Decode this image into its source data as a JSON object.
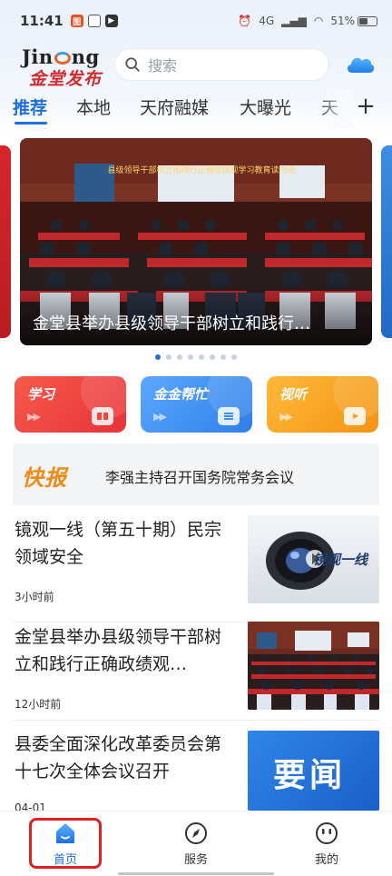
{
  "status_bar": {
    "time": "11:41",
    "network": "4G",
    "battery": "51%"
  },
  "header": {
    "logo_en": "Jin",
    "logo_en_tail": "ng",
    "logo_cn": "金堂发布",
    "search_placeholder": "搜索"
  },
  "tabs": [
    {
      "label": "推荐",
      "active": true
    },
    {
      "label": "本地"
    },
    {
      "label": "天府融媒"
    },
    {
      "label": "大曝光"
    },
    {
      "label": "天"
    }
  ],
  "banner": {
    "caption": "金堂县举办县级领导干部树立和践行…",
    "slide_banner": "县级领导干部树立和践行正确政绩观学习教育读书班",
    "slides": 8,
    "active_slide": 1
  },
  "feature_cards": [
    {
      "label": "学习",
      "color": "#f0463c"
    },
    {
      "label": "金金帮忙",
      "color": "#3a8ff0"
    },
    {
      "label": "视听",
      "color": "#f7a01e"
    }
  ],
  "quick_news": {
    "logo": "快报",
    "text": "李强主持召开国务院常务会议"
  },
  "news": [
    {
      "title": "镜观一线（第五十期）民宗领域安全",
      "time": "3小时前",
      "thumb_text": "镜观一线"
    },
    {
      "title": "金堂县举办县级领导干部树立和践行正确政绩观…",
      "time": "12小时前"
    },
    {
      "title": "县委全面深化改革委员会第十七次全体会议召开",
      "time": "04-01",
      "thumb_text": "要闻"
    }
  ],
  "bottom_nav": [
    {
      "label": "首页",
      "active": true
    },
    {
      "label": "服务"
    },
    {
      "label": "我的"
    }
  ]
}
